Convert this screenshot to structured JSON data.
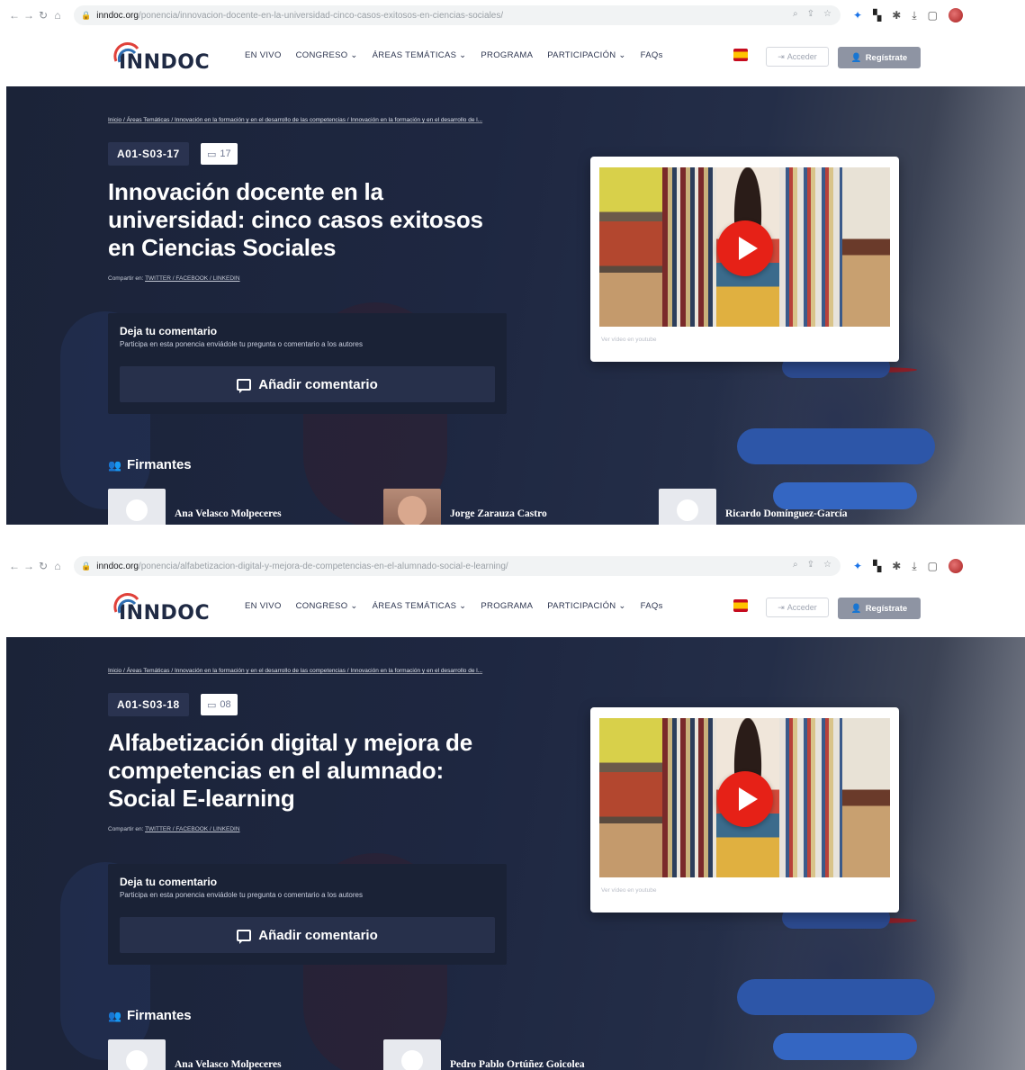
{
  "screens": [
    {
      "browser": {
        "url_host": "inndoc.org",
        "url_path": "/ponencia/innovacion-docente-en-la-universidad-cinco-casos-exitosos-en-ciencias-sociales/"
      },
      "header": {
        "logo": "INNDOC",
        "menu": [
          "EN VIVO",
          "CONGRESO ⌄",
          "ÁREAS TEMÁTICAS ⌄",
          "PROGRAMA",
          "PARTICIPACIÓN ⌄",
          "FAQs"
        ],
        "acceder": "Acceder",
        "registro": "Regístrate"
      },
      "breadcrumb": "Inicio / Áreas Temáticas / Innovación en la formación y en el desarrollo de las competencias / Innovación en la formación y en el desarrollo de l...",
      "code": "A01-S03-17",
      "comment_count": "17",
      "title": "Innovación docente en la universidad: cinco casos exitosos en Ciencias Sociales",
      "share_prefix": "Compartir en: ",
      "share_links": "TWITTER / FACEBOOK / LINKEDIN",
      "comment_box": {
        "heading": "Deja tu comentario",
        "subtext": "Participa en esta ponencia enviádole tu pregunta o comentario a los autores",
        "button": "Añadir comentario"
      },
      "video_caption": "Ver vídeo en youtube",
      "firmantes_heading": "Firmantes",
      "authors": [
        "Ana Velasco Molpeceres",
        "Jorge Zarauza Castro",
        "Ricardo Domínguez-García"
      ]
    },
    {
      "browser": {
        "url_host": "inndoc.org",
        "url_path": "/ponencia/alfabetizacion-digital-y-mejora-de-competencias-en-el-alumnado-social-e-learning/"
      },
      "header": {
        "logo": "INNDOC",
        "menu": [
          "EN VIVO",
          "CONGRESO ⌄",
          "ÁREAS TEMÁTICAS ⌄",
          "PROGRAMA",
          "PARTICIPACIÓN ⌄",
          "FAQs"
        ],
        "acceder": "Acceder",
        "registro": "Regístrate"
      },
      "breadcrumb": "Inicio / Áreas Temáticas / Innovación en la formación y en el desarrollo de las competencias / Innovación en la formación y en el desarrollo de l...",
      "code": "A01-S03-18",
      "comment_count": "08",
      "title": "Alfabetización digital y mejora de competencias en el alumnado: Social E-learning",
      "share_prefix": "Compartir en: ",
      "share_links": "TWITTER / FACEBOOK / LINKEDIN",
      "comment_box": {
        "heading": "Deja tu comentario",
        "subtext": "Participa en esta ponencia enviádole tu pregunta o comentario a los autores",
        "button": "Añadir comentario"
      },
      "video_caption": "Ver vídeo en youtube",
      "firmantes_heading": "Firmantes",
      "authors": [
        "Ana Velasco Molpeceres",
        "Pedro Pablo Ortúñez Goicolea"
      ]
    }
  ]
}
